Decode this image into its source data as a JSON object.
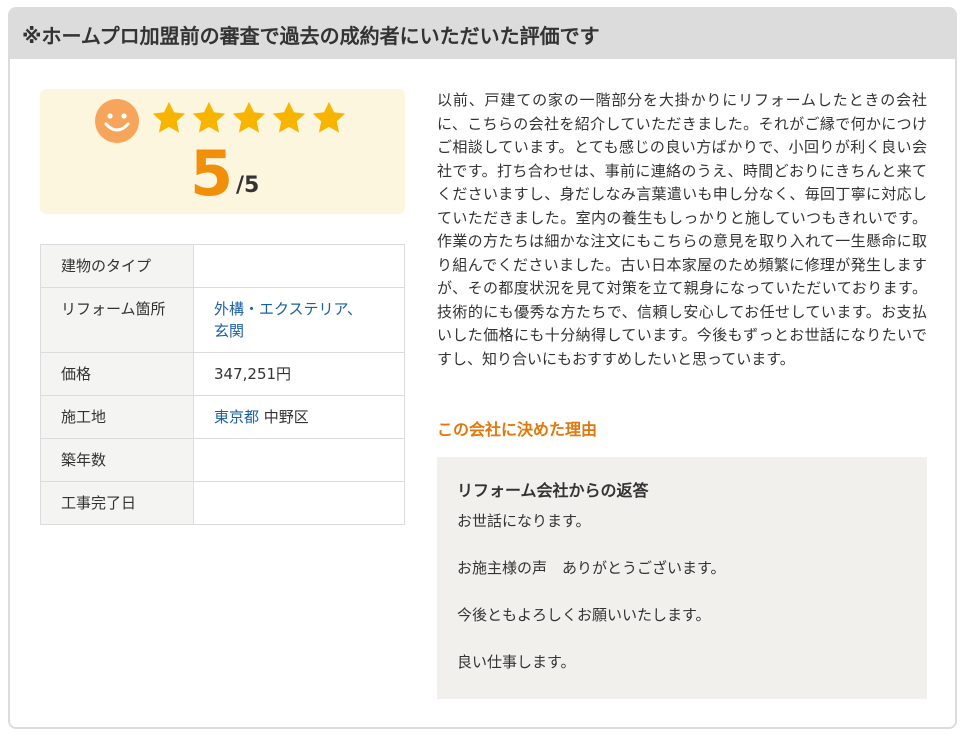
{
  "header": {
    "title": "※ホームプロ加盟前の審査で過去の成約者にいただいた評価です"
  },
  "rating": {
    "score": "5",
    "max": "/5",
    "stars": 5,
    "star_color": "#f7b500",
    "smiley_color": "#f6a55a",
    "score_color": "#f18f0b"
  },
  "info_table": {
    "rows": [
      {
        "label": "建物のタイプ",
        "value": ""
      },
      {
        "label": "リフォーム箇所",
        "value_line1": "外構・エクステリア、",
        "value_line2": "玄関"
      },
      {
        "label": "価格",
        "value": "347,251円"
      },
      {
        "label": "施工地",
        "value_link": "東京都",
        "value_rest": " 中野区"
      },
      {
        "label": "築年数",
        "value": ""
      },
      {
        "label": "工事完了日",
        "value": ""
      }
    ]
  },
  "review": {
    "body": "以前、戸建ての家の一階部分を大掛かりにリフォームしたときの会社に、こちらの会社を紹介していただきました。それがご縁で何かにつけご相談しています。とても感じの良い方ばかりで、小回りが利く良い会社です。打ち合わせは、事前に連絡のうえ、時間どおりにきちんと来てくださいますし、身だしなみ言葉遣いも申し分なく、毎回丁寧に対応していただきました。室内の養生もしっかりと施していつもきれいです。作業の方たちは細かな注文にもこちらの意見を取り入れて一生懸命に取り組んでくださいました。古い日本家屋のため頻繁に修理が発生しますが、その都度状況を見て対策を立て親身になっていただいております。技術的にも優秀な方たちで、信頼し安心してお任せしています。お支払いした価格にも十分納得しています。今後もずっとお世話になりたいですし、知り合いにもおすすめしたいと思っています。"
  },
  "reason": {
    "title": "この会社に決めた理由"
  },
  "reply": {
    "title": "リフォーム会社からの返答",
    "lines": [
      "お世話になります。",
      "お施主様の声　ありがとうございます。",
      "今後ともよろしくお願いいたします。",
      "良い仕事します。"
    ]
  }
}
